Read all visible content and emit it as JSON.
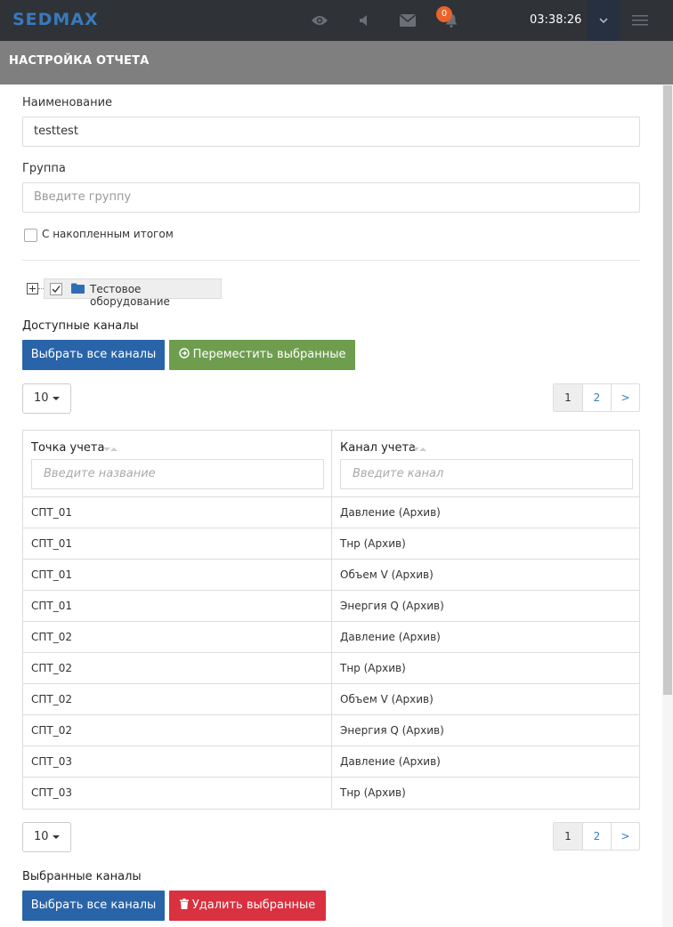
{
  "topbar": {
    "logo": "SEDMAX",
    "notification_count": "0",
    "clock": "03:38:26",
    "icons": [
      "eye-icon",
      "volume-icon",
      "envelope-icon",
      "bell-icon",
      "chevron-down-icon",
      "hamburger-icon"
    ]
  },
  "header": {
    "title": "НАСТРОЙКА ОТЧЕТА"
  },
  "form": {
    "name_label": "Наименование",
    "name_value": "testtest",
    "group_label": "Группа",
    "group_placeholder": "Введите группу",
    "cumulative_label": "С накопленным итогом",
    "cumulative_checked": false
  },
  "tree": {
    "node_label": "Тестовое оборудование",
    "node_checked": true
  },
  "available": {
    "title": "Доступные каналы",
    "select_all_label": "Выбрать все каналы",
    "move_selected_label": "Переместить выбранные",
    "page_size": "10",
    "pages": [
      "1",
      "2",
      ">"
    ],
    "active_page": "1",
    "columns": [
      {
        "title": "Точка учета",
        "filter_placeholder": "Введите название"
      },
      {
        "title": "Канал учета",
        "filter_placeholder": "Введите канал"
      }
    ],
    "rows": [
      [
        "СПТ_01",
        "Давление (Архив)"
      ],
      [
        "СПТ_01",
        "Тнр (Архив)"
      ],
      [
        "СПТ_01",
        "Объем V (Архив)"
      ],
      [
        "СПТ_01",
        "Энергия Q (Архив)"
      ],
      [
        "СПТ_02",
        "Давление (Архив)"
      ],
      [
        "СПТ_02",
        "Тнр (Архив)"
      ],
      [
        "СПТ_02",
        "Объем V (Архив)"
      ],
      [
        "СПТ_02",
        "Энергия Q (Архив)"
      ],
      [
        "СПТ_03",
        "Давление (Архив)"
      ],
      [
        "СПТ_03",
        "Тнр (Архив)"
      ]
    ],
    "bottom_page_size": "10",
    "bottom_pages": [
      "1",
      "2",
      ">"
    ]
  },
  "selected": {
    "title": "Выбранные каналы",
    "select_all_label": "Выбрать все каналы",
    "delete_selected_label": "Удалить выбранные"
  },
  "colors": {
    "topbar": "#2f3236",
    "header": "#7f7f7f",
    "primary": "#2a64a8",
    "success": "#6e9d4e",
    "danger": "#d9313f",
    "badge": "#e9632b"
  }
}
